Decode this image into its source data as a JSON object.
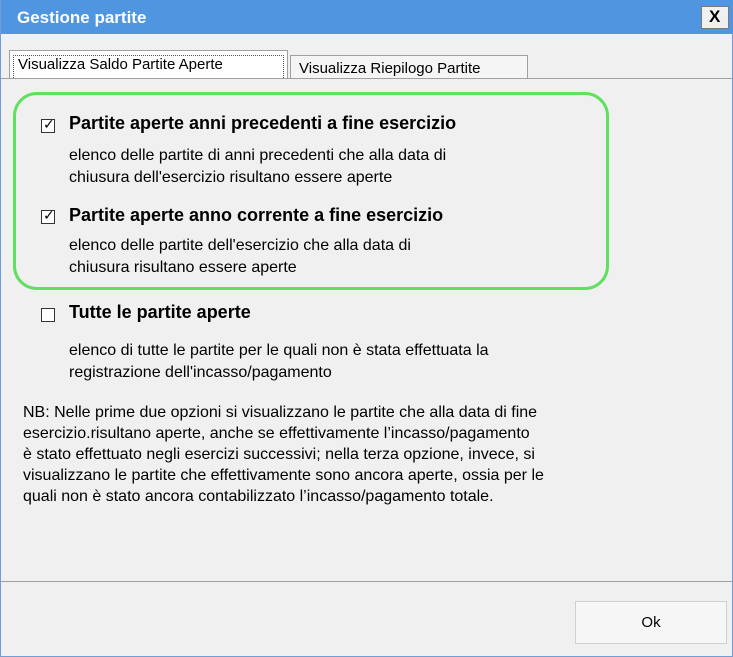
{
  "window": {
    "title": "Gestione partite",
    "close_label": "X"
  },
  "tabs": [
    {
      "label": "Visualizza Saldo Partite Aperte",
      "active": true
    },
    {
      "label": "Visualizza Riepilogo Partite",
      "active": false
    }
  ],
  "options": [
    {
      "checked": true,
      "check_glyph": "✓",
      "title": "Partite aperte anni precedenti a fine esercizio",
      "desc_lines": [
        "elenco delle partite di anni precedenti che alla data di",
        "chiusura dell'esercizio risultano essere aperte"
      ]
    },
    {
      "checked": true,
      "check_glyph": "✓",
      "title": "Partite aperte anno corrente a fine esercizio",
      "desc_lines": [
        "elenco delle partite dell'esercizio che alla data di",
        "chiusura risultano essere aperte"
      ]
    },
    {
      "checked": false,
      "check_glyph": "",
      "title": "Tutte le partite aperte",
      "desc_lines": [
        "elenco di tutte le partite per le quali non è stata effettuata la",
        "registrazione dell'incasso/pagamento"
      ]
    }
  ],
  "note_lines": [
    "NB: Nelle prime due opzioni si visualizzano le partite che alla data di fine",
    "esercizio.risultano aperte, anche se effettivamente l’incasso/pagamento",
    "è stato effettuato negli esercizi successivi; nella terza opzione, invece, si",
    "visualizzano le partite che effettivamente sono ancora aperte, ossia per le",
    "quali non è stato ancora contabilizzato l’incasso/pagamento totale."
  ],
  "buttons": {
    "ok_label": "Ok"
  },
  "colors": {
    "titlebar": "#4f95e0",
    "highlight_border": "#5fe05f"
  }
}
